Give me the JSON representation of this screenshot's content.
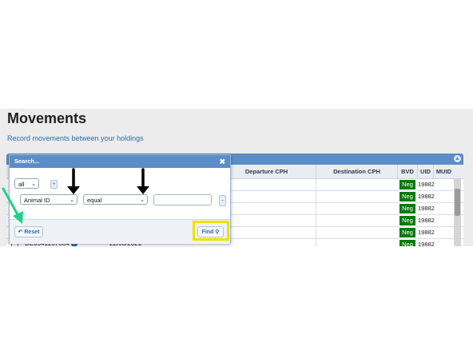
{
  "page": {
    "title": "Movements",
    "subtitle": "Record movements between your holdings"
  },
  "grid": {
    "columns": [
      "Departure CPH",
      "Destination CPH",
      "BVD",
      "UID",
      "MUID"
    ],
    "rows": [
      {
        "bvd": "Neg",
        "uid": "19882"
      },
      {
        "bvd": "Neg",
        "uid": "19882"
      },
      {
        "bvd": "Neg",
        "uid": "19882"
      },
      {
        "bvd": "Neg",
        "uid": "19882"
      },
      {
        "bvd": "Neg",
        "uid": "19882"
      },
      {
        "bvd": "Neg",
        "uid": "19882"
      }
    ],
    "last_row": {
      "id": "DE0541237334",
      "date": "22/03/2021"
    },
    "collapse_icon": "circle-chevron-icon"
  },
  "search_dialog": {
    "title": "Search...",
    "close_icon": "close-icon",
    "group_op": "all",
    "add_label": "+",
    "remove_label": "-",
    "field": "Animal ID",
    "operator": "equal",
    "value": "",
    "reset_label": "Reset",
    "find_label": "Find",
    "reset_icon": "undo-icon",
    "find_icon": "magnifier-icon"
  },
  "annotations": {
    "arrow_color": "#000000",
    "green_arrow_color": "#1fd18a",
    "highlight_color": "#f0e000"
  }
}
